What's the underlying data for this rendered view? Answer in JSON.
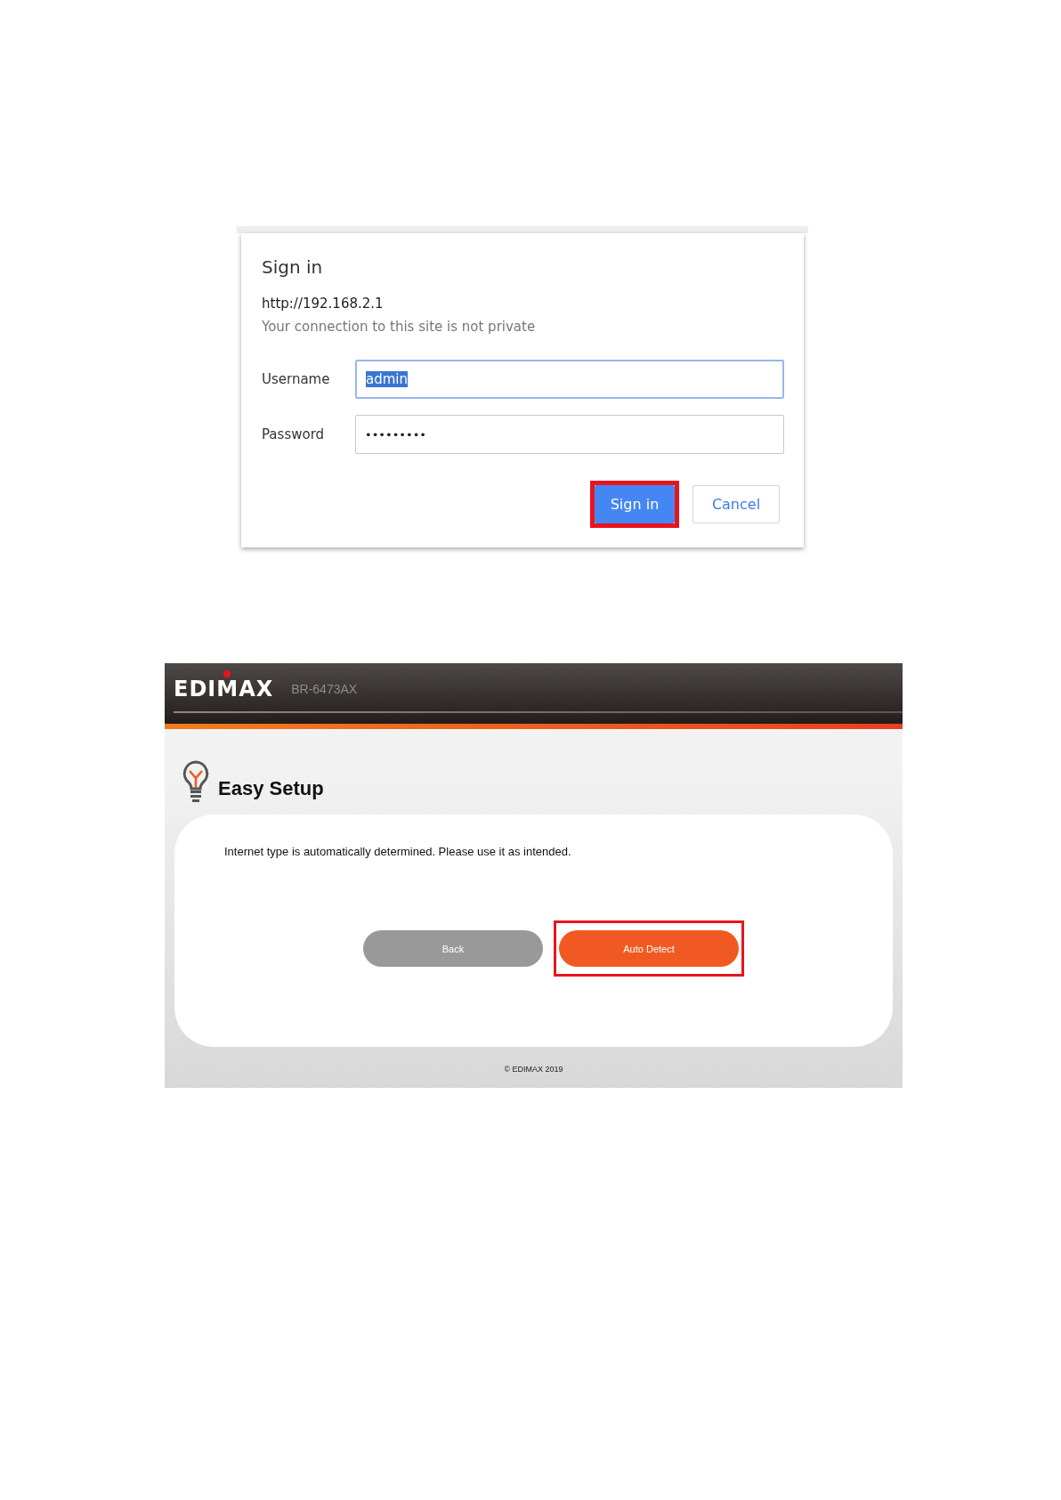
{
  "sign_in_dialog": {
    "title": "Sign in",
    "url": "http://192.168.2.1",
    "notice": "Your connection to this site is not private",
    "fields": [
      {
        "label": "Username",
        "value": "admin",
        "kind": "text",
        "focused": true,
        "text_selected": true
      },
      {
        "label": "Password",
        "value": "•••••••••",
        "kind": "password",
        "focused": false,
        "text_selected": false
      }
    ],
    "buttons": [
      {
        "label": "Sign in",
        "kind": "primary",
        "highlighted": true
      },
      {
        "label": "Cancel",
        "kind": "secondary",
        "highlighted": false
      }
    ]
  },
  "router_page": {
    "logo": "EDIMAX",
    "model": "BR-6473AX",
    "heading": "Easy Setup",
    "message": "Internet type is automatically determined. Please use it as intended.",
    "buttons": [
      {
        "label": "Back",
        "kind": "secondary",
        "highlighted": false
      },
      {
        "label": "Auto Detect",
        "kind": "primary",
        "highlighted": true
      }
    ],
    "footer": "© EDIMAX 2019"
  }
}
